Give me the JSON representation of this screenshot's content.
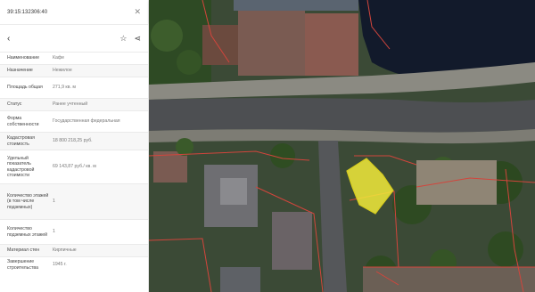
{
  "search": {
    "cadastral_number": "39:15:132306:40"
  },
  "rows": [
    {
      "key": "Наименование",
      "value": "Кафе"
    },
    {
      "key": "Назначение",
      "value": "Нежилое"
    },
    {
      "key": "Площадь общая",
      "value": "271,9 кв. м"
    },
    {
      "key": "Статус",
      "value": "Ранее учтенный"
    },
    {
      "key": "Форма собственности",
      "value": "Государственная федеральная"
    },
    {
      "key": "Кадастровая стоимость",
      "value": "18 800 218,25 руб."
    },
    {
      "key": "Удельный показатель кадастровой стоимости",
      "value": "69 143,87 руб./ кв. м"
    },
    {
      "key": "Количество этажей (в том числе подземных)",
      "value": "1"
    },
    {
      "key": "Количество подземных этажей",
      "value": "1"
    },
    {
      "key": "Материал стен",
      "value": "Кирпичные"
    },
    {
      "key": "Завершение строительства",
      "value": "1945 г."
    }
  ],
  "colors": {
    "highlight": "#f2ea3a",
    "parcel_border": "#d2453c",
    "water": "#101a2e"
  },
  "icons": {
    "back": "chevron-left-icon",
    "favorite": "star-icon",
    "share": "share-icon",
    "clear": "close-icon",
    "collapse": "chevron-left-icon"
  }
}
